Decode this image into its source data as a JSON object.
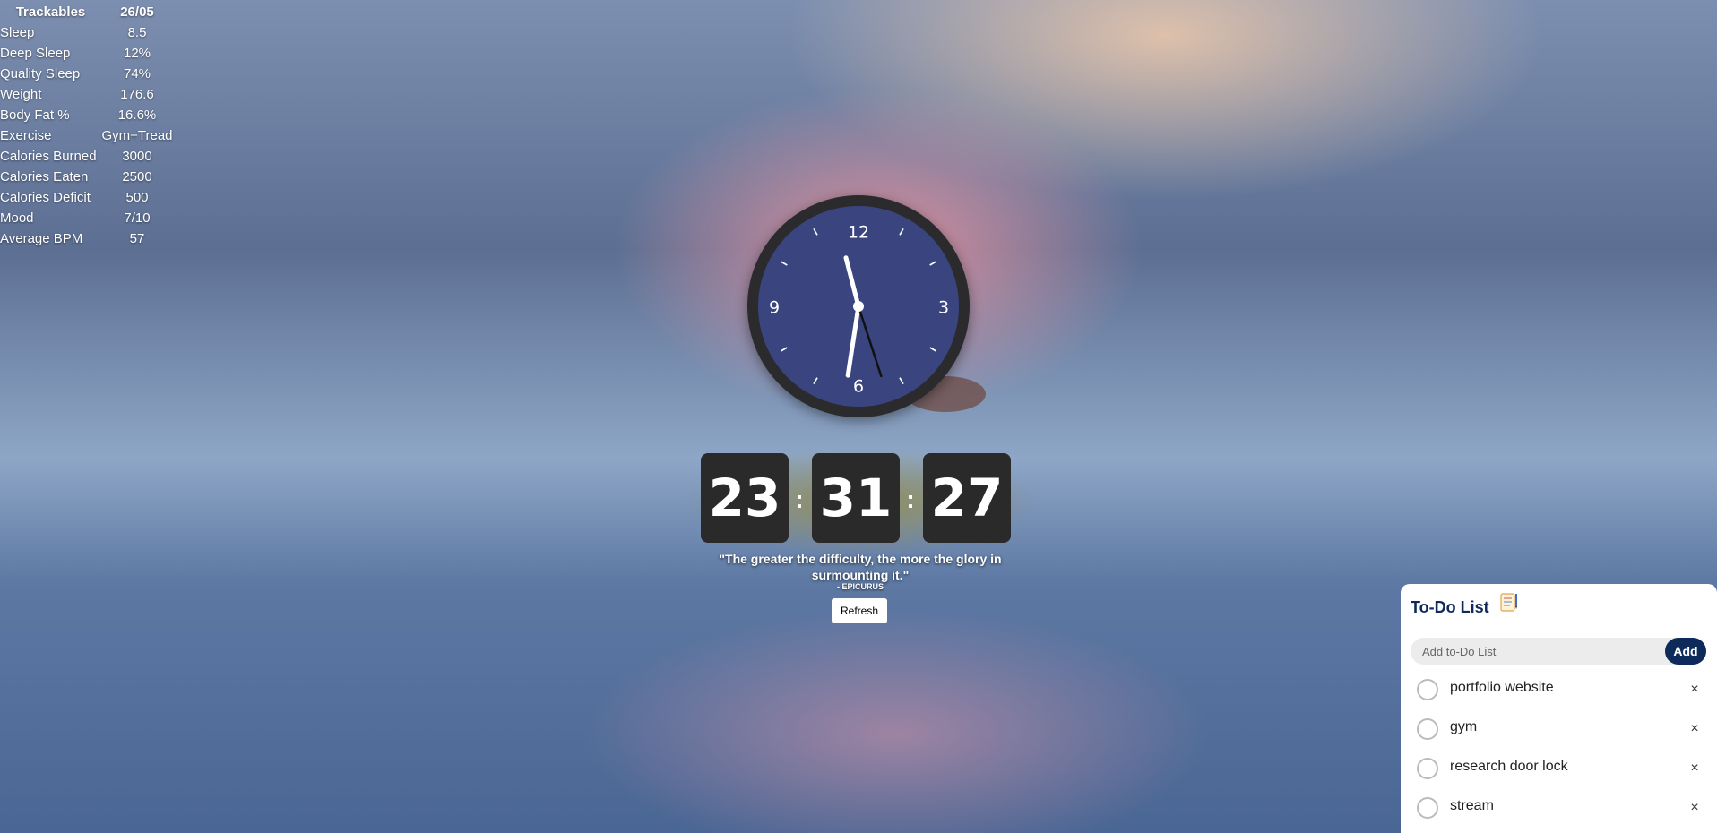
{
  "trackables": {
    "header_label": "Trackables",
    "header_date": "26/05",
    "rows": [
      {
        "label": "Sleep",
        "value": "8.5"
      },
      {
        "label": "Deep Sleep",
        "value": "12%"
      },
      {
        "label": "Quality Sleep",
        "value": "74%"
      },
      {
        "label": "Weight",
        "value": "176.6"
      },
      {
        "label": "Body Fat %",
        "value": "16.6%"
      },
      {
        "label": "Exercise",
        "value": "Gym+Tread"
      },
      {
        "label": "Calories Burned",
        "value": "3000"
      },
      {
        "label": "Calories Eaten",
        "value": "2500"
      },
      {
        "label": "Calories Deficit",
        "value": "500"
      },
      {
        "label": "Mood",
        "value": "7/10"
      },
      {
        "label": "Average BPM",
        "value": "57"
      }
    ]
  },
  "clock": {
    "numbers": {
      "top": "12",
      "right": "3",
      "bottom": "6",
      "left": "9"
    },
    "face_color": "#3a4580",
    "time": {
      "hours": 23,
      "minutes": 31,
      "seconds": 27
    }
  },
  "digital": {
    "hours": "23",
    "minutes": "31",
    "seconds": "27",
    "separator": ":"
  },
  "quote": {
    "text": "\"The greater the difficulty, the more the glory in surmounting it.\"",
    "author": "- EPICURUS",
    "refresh_label": "Refresh"
  },
  "todo": {
    "title": "To-Do List",
    "title_icon": "notepad-icon",
    "placeholder": "Add to-Do List",
    "add_label": "Add",
    "accent_color": "#0e2a5a",
    "items": [
      {
        "text": "portfolio website"
      },
      {
        "text": "gym"
      },
      {
        "text": "research door lock"
      },
      {
        "text": "stream"
      }
    ],
    "delete_glyph": "×"
  }
}
